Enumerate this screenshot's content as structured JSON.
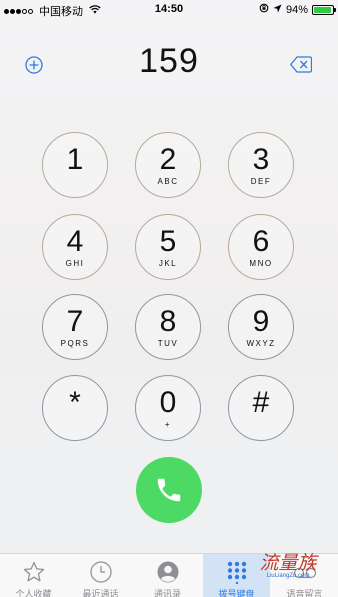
{
  "status_bar": {
    "signal_dots": 5,
    "signal_filled": 3,
    "carrier": "中国移动",
    "wifi_icon": "wifi-icon",
    "time": "14:50",
    "battery_percent": "94%",
    "battery_level": 0.94
  },
  "dialer": {
    "number": "159",
    "add_icon": "plus-circle-icon",
    "delete_icon": "backspace-icon",
    "keys": [
      {
        "digit": "1",
        "letters": ""
      },
      {
        "digit": "2",
        "letters": "ABC"
      },
      {
        "digit": "3",
        "letters": "DEF"
      },
      {
        "digit": "4",
        "letters": "GHI"
      },
      {
        "digit": "5",
        "letters": "JKL"
      },
      {
        "digit": "6",
        "letters": "MNO"
      },
      {
        "digit": "7",
        "letters": "PQRS"
      },
      {
        "digit": "8",
        "letters": "TUV"
      },
      {
        "digit": "9",
        "letters": "WXYZ"
      },
      {
        "digit": "*",
        "letters": ""
      },
      {
        "digit": "0",
        "letters": "+"
      },
      {
        "digit": "#",
        "letters": ""
      }
    ],
    "call_icon": "phone-icon"
  },
  "tab_bar": {
    "tabs": [
      {
        "label": "个人收藏",
        "icon": "star-icon"
      },
      {
        "label": "最近通话",
        "icon": "clock-icon"
      },
      {
        "label": "通讯录",
        "icon": "contacts-icon"
      },
      {
        "label": "拨号键盘",
        "icon": "keypad-icon",
        "active": true
      },
      {
        "label": "语音留言",
        "icon": "voicemail-icon"
      }
    ]
  },
  "watermark": {
    "main": "流量族",
    "sub": "LiuLiangZu.com"
  },
  "colors": {
    "accent": "#2d7be4",
    "call_green": "#4cd964",
    "active_tab_bg": "#d3e3f5"
  }
}
